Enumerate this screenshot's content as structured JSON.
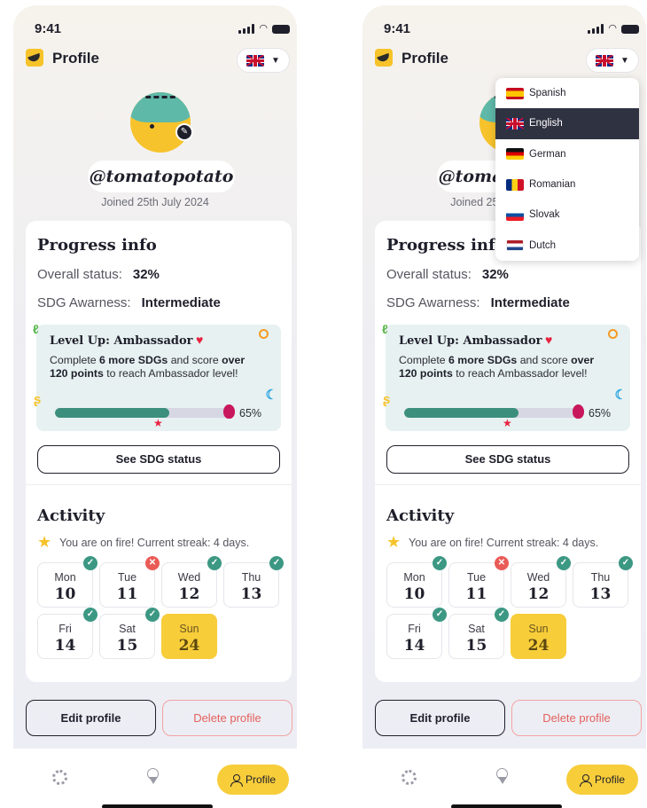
{
  "screens": [
    {
      "status": {
        "time": "9:41"
      },
      "header": {
        "title": "Profile",
        "language_icon": "uk-flag-icon"
      },
      "profile": {
        "username": "@tomatopotato",
        "joined": "Joined 25th July 2024"
      },
      "progress": {
        "title": "Progress info",
        "overall_label": "Overall status:",
        "overall_value": "32%",
        "awareness_label": "SDG Awarness:",
        "awareness_value": "Intermediate",
        "level": {
          "title": "Level Up: Ambassador",
          "desc_1": "Complete ",
          "desc_2": "6 more SDGs",
          "desc_3": " and score ",
          "desc_4": "over 120 points",
          "desc_5": " to reach Ambassador level!",
          "progress_fraction": 0.65,
          "progress_label": "65%"
        },
        "sdg_button": "See SDG status"
      },
      "activity": {
        "title": "Activity",
        "streak": "You are on fire! Current streak: 4 days.",
        "days": [
          {
            "name": "Mon",
            "num": "10",
            "status": "done"
          },
          {
            "name": "Tue",
            "num": "11",
            "status": "missed"
          },
          {
            "name": "Wed",
            "num": "12",
            "status": "done"
          },
          {
            "name": "Thu",
            "num": "13",
            "status": "done"
          },
          {
            "name": "Fri",
            "num": "14",
            "status": "done"
          },
          {
            "name": "Sat",
            "num": "15",
            "status": "done"
          },
          {
            "name": "Sun",
            "num": "24",
            "status": "today"
          }
        ]
      },
      "actions": {
        "edit": "Edit profile",
        "delete": "Delete profile"
      },
      "nav": {
        "profile": "Profile"
      }
    },
    {
      "status": {
        "time": "9:41"
      },
      "header": {
        "title": "Profile",
        "language_icon": "uk-flag-icon"
      },
      "profile": {
        "username": "@tomatopotato",
        "joined": "Joined 25th July 2024"
      },
      "progress": {
        "title": "Progress info",
        "overall_label": "Overall status:",
        "overall_value": "32%",
        "awareness_label": "SDG Awarness:",
        "awareness_value": "Intermediate",
        "level": {
          "title": "Level Up: Ambassador",
          "desc_1": "Complete ",
          "desc_2": "6 more SDGs",
          "desc_3": " and score ",
          "desc_4": "over 120 points",
          "desc_5": " to reach Ambassador level!",
          "progress_fraction": 0.65,
          "progress_label": "65%"
        },
        "sdg_button": "See SDG status"
      },
      "activity": {
        "title": "Activity",
        "streak": "You are on fire! Current streak: 4 days.",
        "days": [
          {
            "name": "Mon",
            "num": "10",
            "status": "done"
          },
          {
            "name": "Tue",
            "num": "11",
            "status": "missed"
          },
          {
            "name": "Wed",
            "num": "12",
            "status": "done"
          },
          {
            "name": "Thu",
            "num": "13",
            "status": "done"
          },
          {
            "name": "Fri",
            "num": "14",
            "status": "done"
          },
          {
            "name": "Sat",
            "num": "15",
            "status": "done"
          },
          {
            "name": "Sun",
            "num": "24",
            "status": "today"
          }
        ]
      },
      "actions": {
        "edit": "Edit profile",
        "delete": "Delete profile"
      },
      "nav": {
        "profile": "Profile"
      },
      "language_menu": {
        "selected": "English",
        "options": [
          {
            "label": "Spanish",
            "flag": "spain-flag-icon"
          },
          {
            "label": "English",
            "flag": "uk-flag-icon"
          },
          {
            "label": "German",
            "flag": "germany-flag-icon"
          },
          {
            "label": "Romanian",
            "flag": "romania-flag-icon"
          },
          {
            "label": "Slovak",
            "flag": "slovakia-flag-icon"
          },
          {
            "label": "Dutch",
            "flag": "netherlands-flag-icon"
          }
        ]
      }
    }
  ],
  "colors": {
    "accent_yellow": "#f7cd3a",
    "progress_green": "#3c8f7c",
    "danger_red": "#e3615c",
    "menu_selected": "#2f3241"
  }
}
